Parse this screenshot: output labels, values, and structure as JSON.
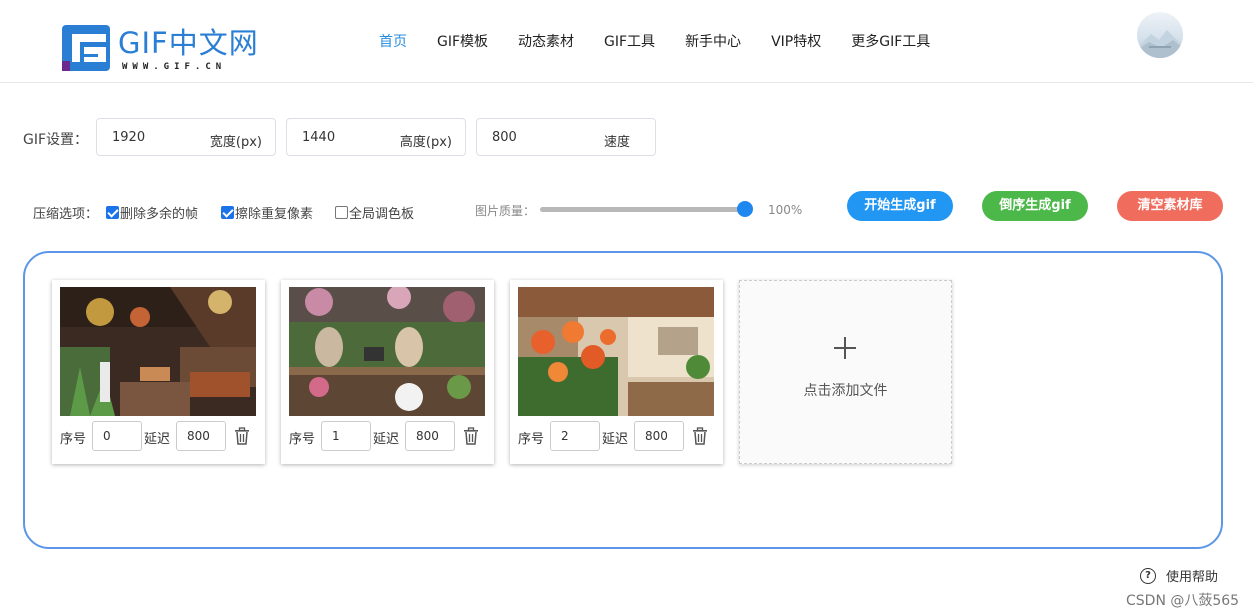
{
  "header": {
    "logo_text": "GIF中文网",
    "logo_sub": "WWW.GIF.CN",
    "nav": [
      {
        "label": "首页",
        "active": true
      },
      {
        "label": "GIF模板",
        "active": false
      },
      {
        "label": "动态素材",
        "active": false
      },
      {
        "label": "GIF工具",
        "active": false
      },
      {
        "label": "新手中心",
        "active": false
      },
      {
        "label": "VIP特权",
        "active": false
      },
      {
        "label": "更多GIF工具",
        "active": false
      }
    ]
  },
  "settings": {
    "label": "GIF设置：",
    "width_value": "1920",
    "width_unit": "宽度(px)",
    "height_value": "1440",
    "height_unit": "高度(px)",
    "speed_value": "800",
    "speed_unit": "速度"
  },
  "compression": {
    "label": "压缩选项：",
    "options": [
      {
        "label": "删除多余的帧",
        "checked": true
      },
      {
        "label": "擦除重复像素",
        "checked": true
      },
      {
        "label": "全局调色板",
        "checked": false
      }
    ],
    "quality_label": "图片质量：",
    "quality_value": "100%",
    "quality_fraction": 1.0
  },
  "buttons": {
    "start": "开始生成gif",
    "reverse": "倒序生成gif",
    "clear": "清空素材库"
  },
  "colors": {
    "accent": "#2196f3",
    "start_button": "#2196f3",
    "reverse_button": "#4cb849",
    "clear_button": "#f06d5e",
    "border": "#5b97e6"
  },
  "frames": [
    {
      "order_label": "序号",
      "order": "0",
      "delay_label": "延迟",
      "delay": "800"
    },
    {
      "order_label": "序号",
      "order": "1",
      "delay_label": "延迟",
      "delay": "800"
    },
    {
      "order_label": "序号",
      "order": "2",
      "delay_label": "延迟",
      "delay": "800"
    }
  ],
  "add_file": "点击添加文件",
  "help": "使用帮助",
  "watermark": "CSDN @八蔹565"
}
